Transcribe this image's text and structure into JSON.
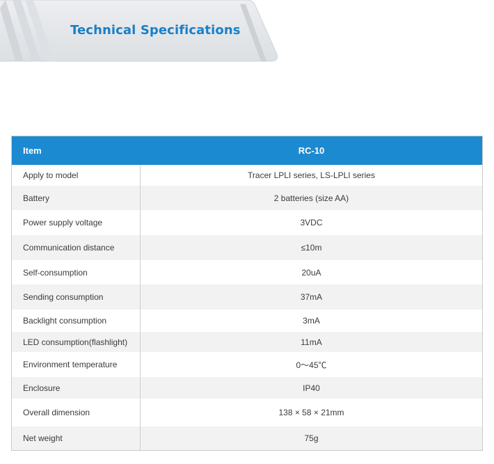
{
  "banner": {
    "title": "Technical Specifications"
  },
  "table": {
    "header": {
      "item_label": "Item",
      "model_label": "RC-10"
    },
    "rows": [
      {
        "item": "Apply to model",
        "value": "Tracer LPLI series, LS-LPLI series"
      },
      {
        "item": "Battery",
        "value": "2 batteries (size AA)"
      },
      {
        "item": "Power supply voltage",
        "value": "3VDC"
      },
      {
        "item": "Communication distance",
        "value": "≤10m"
      },
      {
        "item": "Self-consumption",
        "value": "20uA"
      },
      {
        "item": "Sending consumption",
        "value": "37mA"
      },
      {
        "item": "Backlight consumption",
        "value": "3mA"
      },
      {
        "item": "LED consumption(flashlight)",
        "value": "11mA"
      },
      {
        "item": "Environment temperature",
        "value": "0～45℃"
      },
      {
        "item": "Enclosure",
        "value": "IP40"
      },
      {
        "item": "Overall dimension",
        "value": "138 × 58 × 21mm"
      },
      {
        "item": "Net weight",
        "value": "75g"
      }
    ]
  },
  "colors": {
    "header_bg": "#1c8ad0",
    "title_blue": "#1a7fc8",
    "banner_gray": "#e3e5e8"
  }
}
